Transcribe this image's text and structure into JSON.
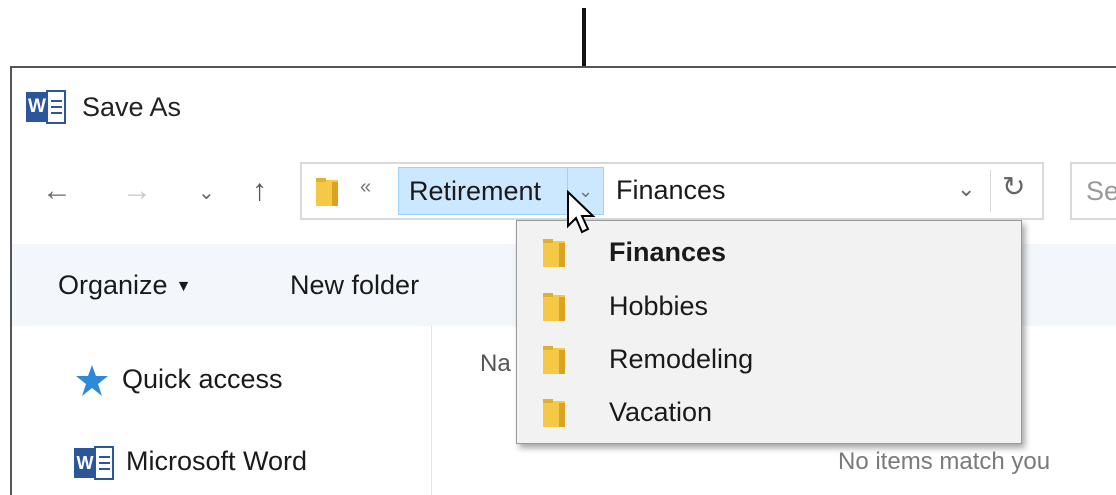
{
  "window": {
    "title": "Save As"
  },
  "address": {
    "overflow_chevron": "«",
    "breadcrumb": "Retirement",
    "breadcrumb_dropdown": "⌄",
    "current": "Finances",
    "dropdown": "⌄",
    "refresh": "↻"
  },
  "nav": {
    "back": "←",
    "forward": "→",
    "recent": "⌄",
    "up": "↑"
  },
  "search": {
    "placeholder": "Se"
  },
  "toolbar": {
    "organize": "Organize",
    "organize_caret": "▼",
    "new_folder": "New folder"
  },
  "sidebar": {
    "items": [
      {
        "label": "Quick access"
      },
      {
        "label": "Microsoft Word"
      }
    ]
  },
  "content": {
    "column_name": "Na",
    "empty_message": "No items match you"
  },
  "folder_menu": {
    "items": [
      {
        "label": "Finances",
        "selected": true
      },
      {
        "label": "Hobbies"
      },
      {
        "label": "Remodeling"
      },
      {
        "label": "Vacation"
      }
    ]
  },
  "colors": {
    "folder": "#f5c945",
    "selection": "#cce8ff",
    "word_blue": "#2b579a",
    "toolbar_bg": "#f3f7fb"
  }
}
